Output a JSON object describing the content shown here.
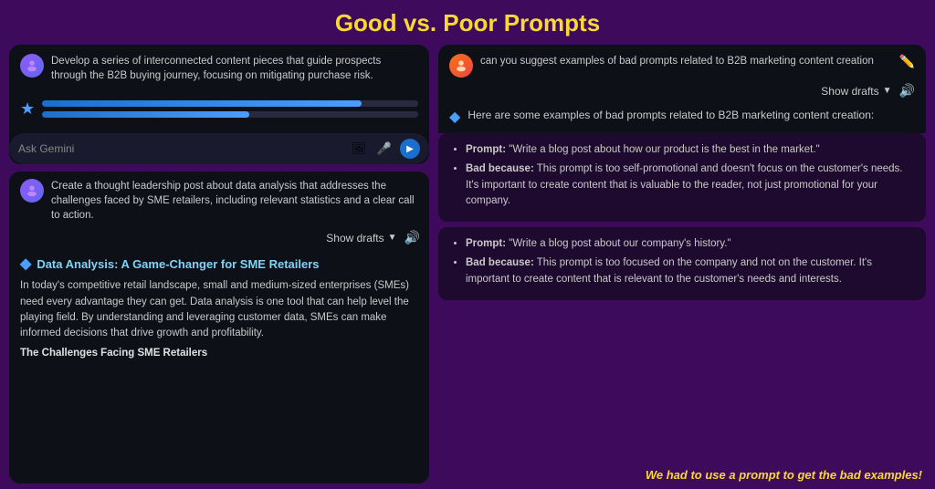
{
  "page": {
    "title": "Good vs. Poor Prompts",
    "bg_color": "#3d0a5c"
  },
  "left": {
    "top_box": {
      "user_message": "Develop a series of interconnected content pieces that guide prospects through the B2B buying journey, focusing on mitigating purchase risk.",
      "progress_bar1_width": "85%",
      "progress_bar2_width": "55%",
      "ask_gemini_placeholder": "Ask Gemini"
    },
    "bottom_box": {
      "user_message": "Create a thought leadership post about data analysis that addresses the challenges faced by SME retailers, including relevant statistics and a clear call to action.",
      "show_drafts_label": "Show drafts",
      "response_title": "Data Analysis: A Game-Changer for SME Retailers",
      "response_body_p1": "In today's competitive retail landscape, small and medium-sized enterprises (SMEs) need every advantage they can get. Data analysis is one tool that can help level the playing field. By understanding and leveraging customer data, SMEs can make informed decisions that drive growth and profitability.",
      "response_body_p2": "The Challenges Facing SME Retailers"
    }
  },
  "right": {
    "user_message": "can you suggest examples of bad prompts related to B2B marketing content creation",
    "show_drafts_label": "Show drafts",
    "ai_intro": "Here are some examples of bad prompts related to B2B marketing content creation:",
    "cards": [
      {
        "prompt_label": "Prompt:",
        "prompt_text": "\"Write a blog post about how our product is the best in the market.\"",
        "bad_because_label": "Bad because:",
        "bad_because_text": "This prompt is too self-promotional and doesn't focus on the customer's needs. It's important to create content that is valuable to the reader, not just promotional for your company."
      },
      {
        "prompt_label": "Prompt:",
        "prompt_text": "\"Write a blog post about our company's history.\"",
        "bad_because_label": "Bad because:",
        "bad_because_text": "This prompt is too focused on the company and not on the customer. It's important to create content that is relevant to the customer's needs and interests."
      }
    ],
    "bottom_note": "We had to use a prompt to get the bad examples!"
  }
}
